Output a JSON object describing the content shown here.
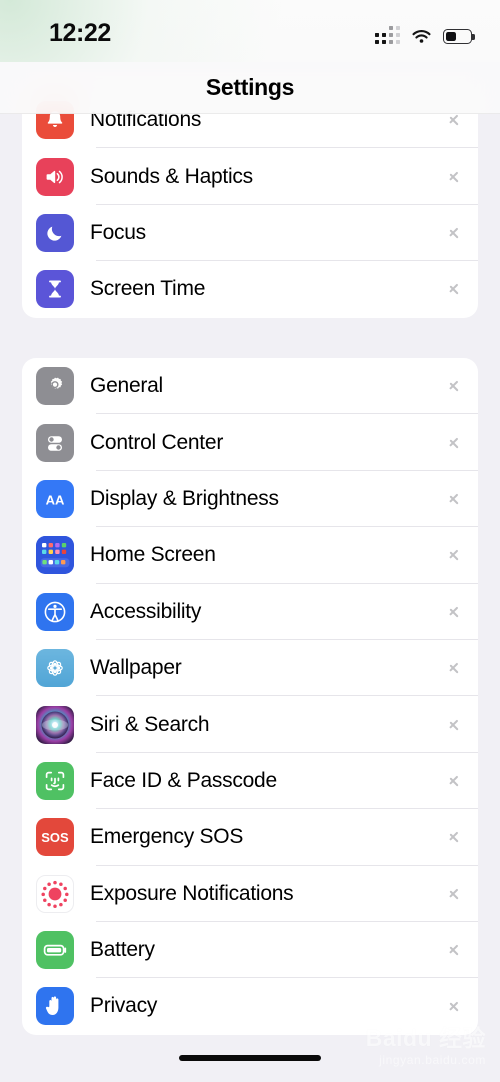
{
  "status_bar": {
    "time": "12:22",
    "cellular_icon": "cellular-signal-icon",
    "wifi_icon": "wifi-icon",
    "battery_icon": "battery-icon",
    "battery_level_percent": 42
  },
  "nav": {
    "title": "Settings"
  },
  "colors": {
    "page_background": "#f1f0f5",
    "card_background": "#ffffff",
    "separator": "#e6e5ea",
    "chevron": "#c3c3c6",
    "label_text": "#000000"
  },
  "groups": [
    {
      "id": "group-1",
      "rows": [
        {
          "label": "Notifications",
          "icon": "bell-icon",
          "icon_color": "#ea4c3a",
          "clipped": true
        },
        {
          "label": "Sounds & Haptics",
          "icon": "speaker-wave-icon",
          "icon_color": "#e8415a"
        },
        {
          "label": "Focus",
          "icon": "moon-icon",
          "icon_color": "#5457d4"
        },
        {
          "label": "Screen Time",
          "icon": "hourglass-icon",
          "icon_color": "#5b55d8"
        }
      ]
    },
    {
      "id": "group-2",
      "rows": [
        {
          "label": "General",
          "icon": "gear-icon",
          "icon_color": "#8e8e93"
        },
        {
          "label": "Control Center",
          "icon": "toggles-icon",
          "icon_color": "#8e8e93"
        },
        {
          "label": "Display & Brightness",
          "icon": "aa-text-size-icon",
          "icon_color": "#3478f6"
        },
        {
          "label": "Home Screen",
          "icon": "app-grid-icon",
          "icon_color": "#2a50d8"
        },
        {
          "label": "Accessibility",
          "icon": "accessibility-icon",
          "icon_color": "#2f74ef"
        },
        {
          "label": "Wallpaper",
          "icon": "flower-icon",
          "icon_color": "#51a5d6"
        },
        {
          "label": "Siri & Search",
          "icon": "siri-orb-icon",
          "icon_color": "#2b1636"
        },
        {
          "label": "Face ID & Passcode",
          "icon": "face-id-icon",
          "icon_color": "#4fc163"
        },
        {
          "label": "Emergency SOS",
          "icon": "sos-icon",
          "icon_color": "#e3483b"
        },
        {
          "label": "Exposure Notifications",
          "icon": "exposure-dots-icon",
          "icon_color": "#ffffff"
        },
        {
          "label": "Battery",
          "icon": "battery-icon",
          "icon_color": "#4fc163"
        },
        {
          "label": "Privacy",
          "icon": "hand-raised-icon",
          "icon_color": "#2f74ef"
        }
      ]
    }
  ],
  "watermark": {
    "main": "Baidu 经验",
    "sub": "jingyan.baidu.com"
  },
  "home_indicator": "home-indicator"
}
